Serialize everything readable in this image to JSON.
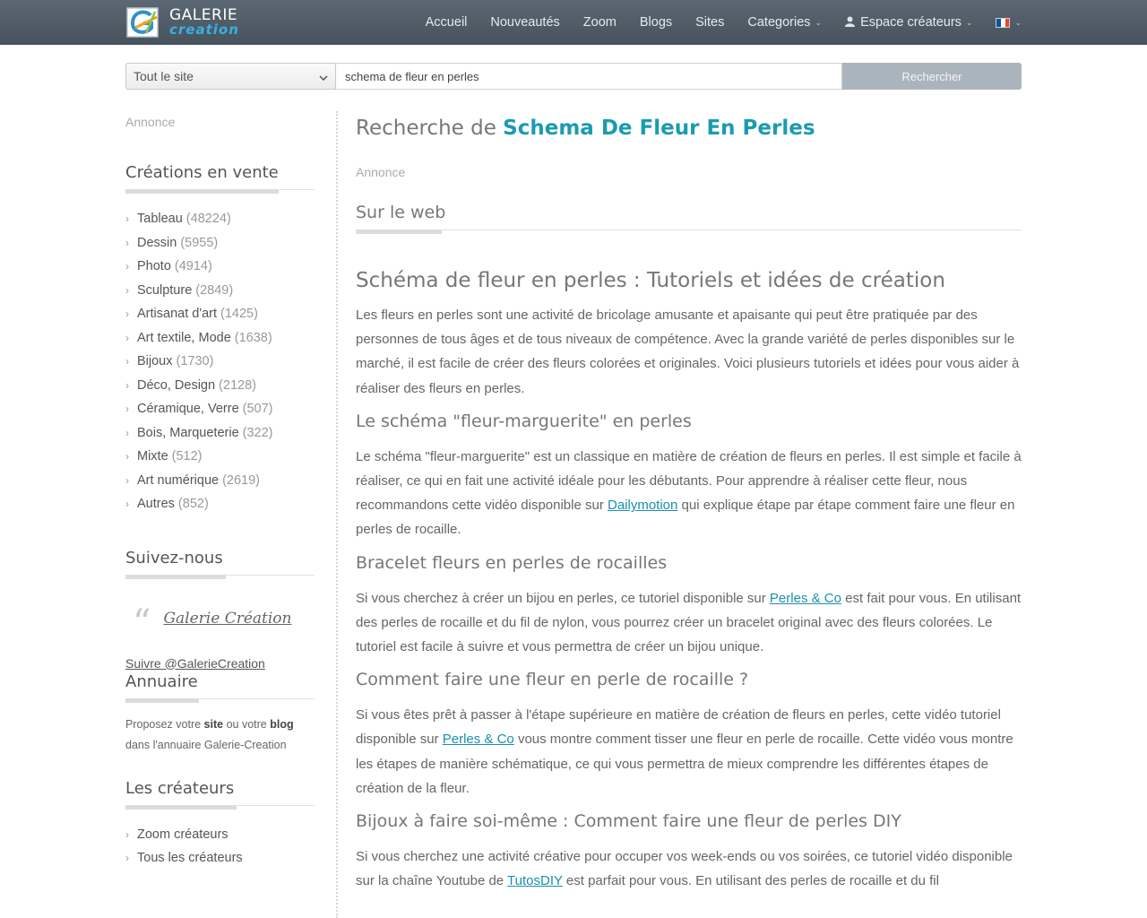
{
  "logo": {
    "top": "Galerie",
    "bottom": "creation"
  },
  "nav": {
    "items": [
      "Accueil",
      "Nouveautés",
      "Zoom",
      "Blogs",
      "Sites"
    ],
    "categories": "Categories",
    "creators_space": "Espace créateurs",
    "flag_colors": [
      "#0055a4",
      "#ffffff",
      "#ef4135"
    ]
  },
  "search": {
    "scope": "Tout le site",
    "query": "schema de fleur en perles",
    "button": "Rechercher"
  },
  "sidebar": {
    "annonce": "Annonce",
    "sale_title": "Créations en vente",
    "categories": [
      {
        "label": "Tableau",
        "count": "(48224)"
      },
      {
        "label": "Dessin",
        "count": "(5955)"
      },
      {
        "label": "Photo",
        "count": "(4914)"
      },
      {
        "label": "Sculpture",
        "count": "(2849)"
      },
      {
        "label": "Artisanat d'art",
        "count": "(1425)"
      },
      {
        "label": "Art textile, Mode",
        "count": "(1638)"
      },
      {
        "label": "Bijoux",
        "count": "(1730)"
      },
      {
        "label": "Déco, Design",
        "count": "(2128)"
      },
      {
        "label": "Céramique, Verre",
        "count": "(507)"
      },
      {
        "label": "Bois, Marqueterie",
        "count": "(322)"
      },
      {
        "label": "Mixte",
        "count": "(512)"
      },
      {
        "label": "Art numérique",
        "count": "(2619)"
      },
      {
        "label": "Autres",
        "count": "(852)"
      }
    ],
    "follow_title": "Suivez-nous",
    "quote_link": "Galerie Création",
    "follow_link": "Suivre @GalerieCreation",
    "annuaire_title": "Annuaire",
    "annuaire": {
      "t1": "Proposez votre ",
      "site": "site",
      "t2": " ou votre ",
      "blog": "blog",
      "t3": "dans l'annuaire Galerie-Creation"
    },
    "creators_title": "Les créateurs",
    "creators": [
      "Zoom créateurs",
      "Tous les créateurs"
    ]
  },
  "main": {
    "title_prefix": "Recherche de ",
    "title_query": "Schema De Fleur En Perles",
    "annonce": "Annonce",
    "web_title": "Sur le web",
    "h1": "Schéma de fleur en perles : Tutoriels et idées de création",
    "intro": "Les fleurs en perles sont une activité de bricolage amusante et apaisante qui peut être pratiquée par des personnes de tous âges et de tous niveaux de compétence. Avec la grande variété de perles disponibles sur le marché, il est facile de créer des fleurs colorées et originales. Voici plusieurs tutoriels et idées pour vous aider à réaliser des fleurs en perles.",
    "s1": {
      "title": "Le schéma \"fleur-marguerite\" en perles",
      "p1": "Le schéma \"fleur-marguerite\" est un classique en matière de création de fleurs en perles. Il est simple et facile à réaliser, ce qui en fait une activité idéale pour les débutants. Pour apprendre à réaliser cette fleur, nous recommandons cette vidéo disponible sur ",
      "link": "Dailymotion",
      "p2": " qui explique étape par étape comment faire une fleur en perles de rocaille."
    },
    "s2": {
      "title": "Bracelet fleurs en perles de rocailles",
      "p1": "Si vous cherchez à créer un bijou en perles, ce tutoriel disponible sur ",
      "link": "Perles & Co",
      "p2": " est fait pour vous. En utilisant des perles de rocaille et du fil de nylon, vous pourrez créer un bracelet original avec des fleurs colorées. Le tutoriel est facile à suivre et vous permettra de créer un bijou unique."
    },
    "s3": {
      "title": "Comment faire une fleur en perle de rocaille ?",
      "p1": "Si vous êtes prêt à passer à l'étape supérieure en matière de création de fleurs en perles, cette vidéo tutoriel disponible sur ",
      "link": "Perles & Co",
      "p2": " vous montre comment tisser une fleur en perle de rocaille. Cette vidéo vous montre les étapes de manière schématique, ce qui vous permettra de mieux comprendre les différentes étapes de création de la fleur."
    },
    "s4": {
      "title": "Bijoux à faire soi-même : Comment faire une fleur de perles DIY",
      "p1": "Si vous cherchez une activité créative pour occuper vos week-ends ou vos soirées, ce tutoriel vidéo disponible sur la chaîne Youtube de ",
      "link": "TutosDIY",
      "p2": " est parfait pour vous. En utilisant des perles de rocaille et du fil"
    }
  }
}
